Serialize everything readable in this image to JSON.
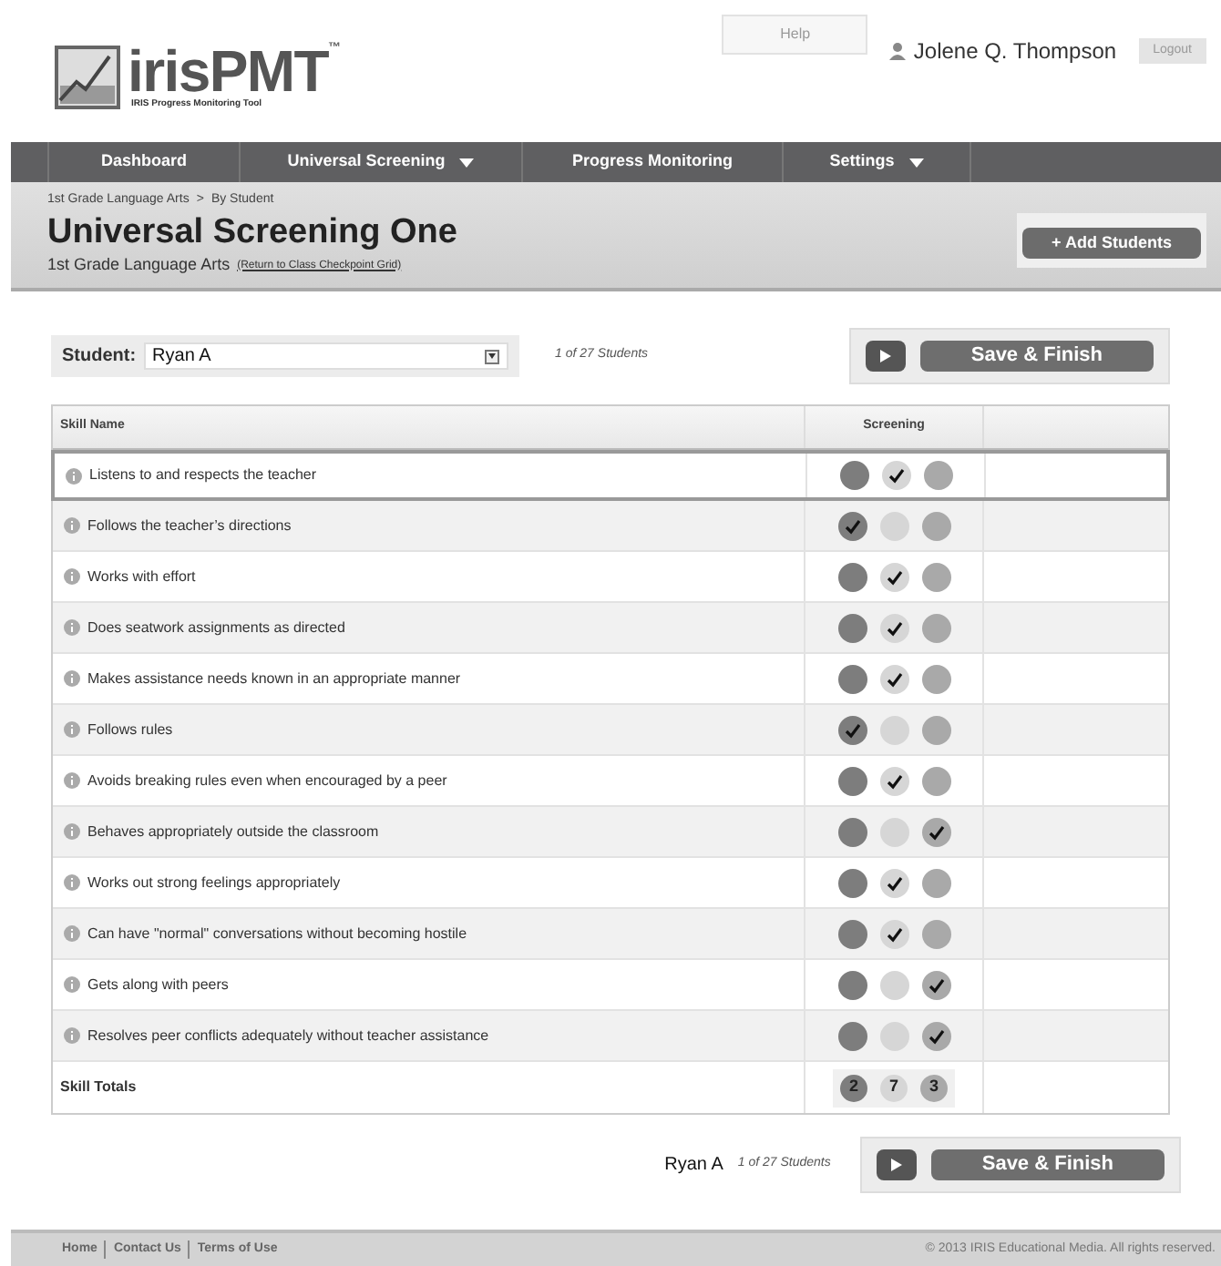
{
  "header": {
    "logo": {
      "name": "irisPMT",
      "trademark": "™",
      "tagline": "IRIS Progress Monitoring Tool"
    },
    "help": "Help",
    "user": "Jolene Q. Thompson",
    "logout": "Logout"
  },
  "nav": [
    {
      "label": "Dashboard",
      "dropdown": false
    },
    {
      "label": "Universal Screening",
      "dropdown": true
    },
    {
      "label": "Progress Monitoring",
      "dropdown": false
    },
    {
      "label": "Settings",
      "dropdown": true
    }
  ],
  "breadcrumb": [
    "1st Grade Language Arts",
    ">",
    "By Student"
  ],
  "title": "Universal Screening One",
  "subtitle": "1st Grade Language Arts",
  "return_link": "(Return to Class Checkpoint Grid)",
  "add_button": "+ Add Students",
  "student": {
    "label": "Student:",
    "value": "Ryan A",
    "count": "1 of 27 Students"
  },
  "save_button": "Save & Finish",
  "bottom": {
    "student": "Ryan A",
    "count": "1 of 27 Students",
    "save_button": "Save & Finish"
  },
  "table": {
    "columns": [
      "Skill Name",
      "Screening"
    ],
    "rows": [
      {
        "skill": "Listens to and respects the teacher",
        "selected": true,
        "rating": [
          false,
          true,
          false
        ]
      },
      {
        "skill": "Follows the teacher’s directions",
        "selected": false,
        "rating": [
          true,
          false,
          false
        ]
      },
      {
        "skill": "Works with effort",
        "selected": false,
        "rating": [
          false,
          true,
          false
        ]
      },
      {
        "skill": "Does seatwork assignments as directed",
        "selected": false,
        "rating": [
          false,
          true,
          false
        ]
      },
      {
        "skill": "Makes assistance needs known in an appropriate manner",
        "selected": false,
        "rating": [
          false,
          true,
          false
        ]
      },
      {
        "skill": "Follows rules",
        "selected": false,
        "rating": [
          true,
          false,
          false
        ]
      },
      {
        "skill": "Avoids breaking rules even when encouraged by a peer",
        "selected": false,
        "rating": [
          false,
          true,
          false
        ]
      },
      {
        "skill": "Behaves appropriately outside the classroom",
        "selected": false,
        "rating": [
          false,
          false,
          true
        ]
      },
      {
        "skill": "Works out strong feelings appropriately",
        "selected": false,
        "rating": [
          false,
          true,
          false
        ]
      },
      {
        "skill": "Can have \"normal\" conversations without becoming hostile",
        "selected": false,
        "rating": [
          false,
          true,
          false
        ]
      },
      {
        "skill": "Gets along with peers",
        "selected": false,
        "rating": [
          false,
          false,
          true
        ]
      },
      {
        "skill": "Resolves peer conflicts adequately without teacher assistance",
        "selected": false,
        "rating": [
          false,
          false,
          true
        ]
      }
    ],
    "totals": {
      "label": "Skill Totals",
      "values": [
        "2",
        "7",
        "3"
      ]
    }
  },
  "footer": {
    "links": [
      "Home",
      "Contact Us",
      "Terms of Use"
    ],
    "copyright": "© 2013 IRIS Educational Media. All rights reserved."
  }
}
